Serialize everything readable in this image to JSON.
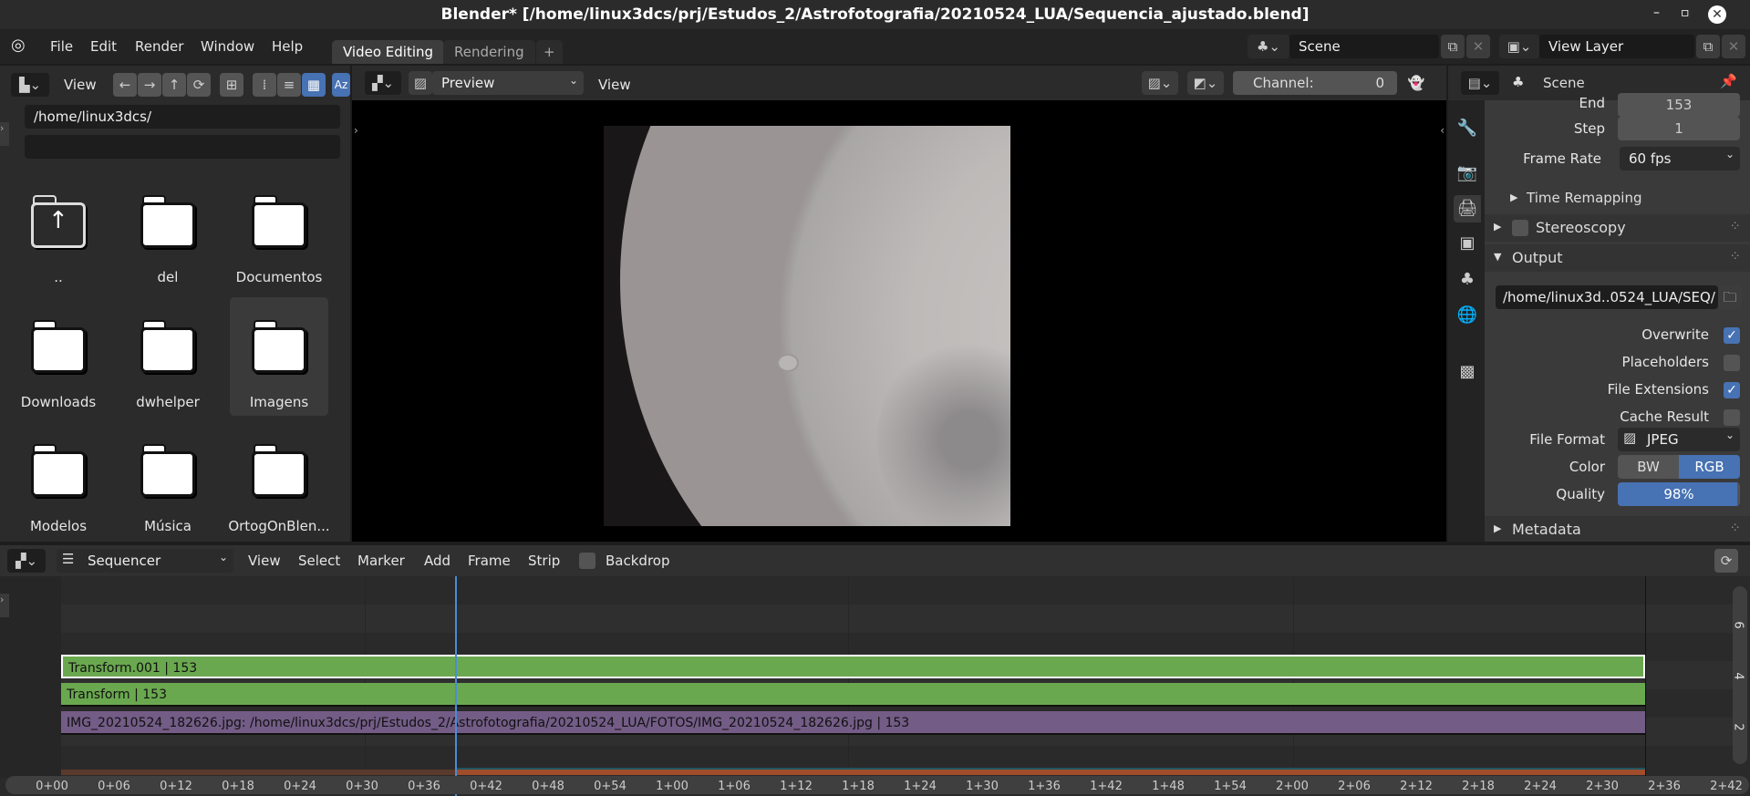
{
  "window": {
    "title": "Blender* [/home/linux3dcs/prj/Estudos_2/Astrofotografia/20210524_LUA/Sequencia_ajustado.blend]"
  },
  "menu": {
    "items": [
      "File",
      "Edit",
      "Render",
      "Window",
      "Help"
    ],
    "workspaces": [
      "Video Editing",
      "Rendering"
    ],
    "add": "+",
    "scene": "Scene",
    "view_layer": "View Layer"
  },
  "file_browser": {
    "view": "View",
    "path": "/home/linux3dcs/",
    "filter": "",
    "items": [
      "..",
      "del",
      "Documentos",
      "Downloads",
      "dwhelper",
      "Imagens",
      "Modelos",
      "Música",
      "OrtogOnBlen..."
    ],
    "selected": "Imagens"
  },
  "preview": {
    "mode": "Preview",
    "view": "View",
    "channel_label": "Channel:",
    "channel_value": "0"
  },
  "properties": {
    "context": "Scene",
    "end_label": "End",
    "end_value": "153",
    "step_label": "Step",
    "step_value": "1",
    "frame_rate_label": "Frame Rate",
    "frame_rate": "60 fps",
    "time_remapping": "Time Remapping",
    "stereoscopy": "Stereoscopy",
    "output": "Output",
    "output_path": "/home/linux3d..0524_LUA/SEQ/",
    "checks": [
      {
        "label": "Overwrite",
        "on": true
      },
      {
        "label": "Placeholders",
        "on": false
      },
      {
        "label": "File Extensions",
        "on": true
      },
      {
        "label": "Cache Result",
        "on": false
      }
    ],
    "file_format_label": "File Format",
    "file_format": "JPEG",
    "color_label": "Color",
    "color_bw": "BW",
    "color_rgb": "RGB",
    "color_selected": "RGB",
    "quality_label": "Quality",
    "quality": "98%",
    "quality_value": 98,
    "metadata": "Metadata"
  },
  "sequencer": {
    "editor": "Sequencer",
    "menus": [
      "View",
      "Select",
      "Marker",
      "Add",
      "Frame",
      "Strip"
    ],
    "backdrop": "Backdrop",
    "strips": [
      {
        "label": "Transform.001 | 153",
        "color": "#6aa84f",
        "selected": true
      },
      {
        "label": "Transform | 153",
        "color": "#6aa84f",
        "selected": false
      },
      {
        "label": "IMG_20210524_182626.jpg: /home/linux3dcs/prj/Estudos_2/Astrofotografia/20210524_LUA/FOTOS/IMG_20210524_182626.jpg | 153",
        "color": "#735c86",
        "selected": false
      }
    ],
    "ticks": [
      "0+00",
      "0+06",
      "0+12",
      "0+18",
      "0+24",
      "0+30",
      "0+36",
      "0+42",
      "0+48",
      "0+54",
      "1+00",
      "1+06",
      "1+12",
      "1+18",
      "1+24",
      "1+30",
      "1+36",
      "1+42",
      "1+48",
      "1+54",
      "2+00",
      "2+06",
      "2+12",
      "2+18",
      "2+24",
      "2+30",
      "2+36",
      "2+42"
    ],
    "channels": [
      "6",
      "4",
      "2"
    ]
  },
  "colors": {
    "accent": "#4772b3",
    "playhead": "#4b8bd6",
    "strip_green": "#6aa84f",
    "strip_purple": "#735c86"
  }
}
